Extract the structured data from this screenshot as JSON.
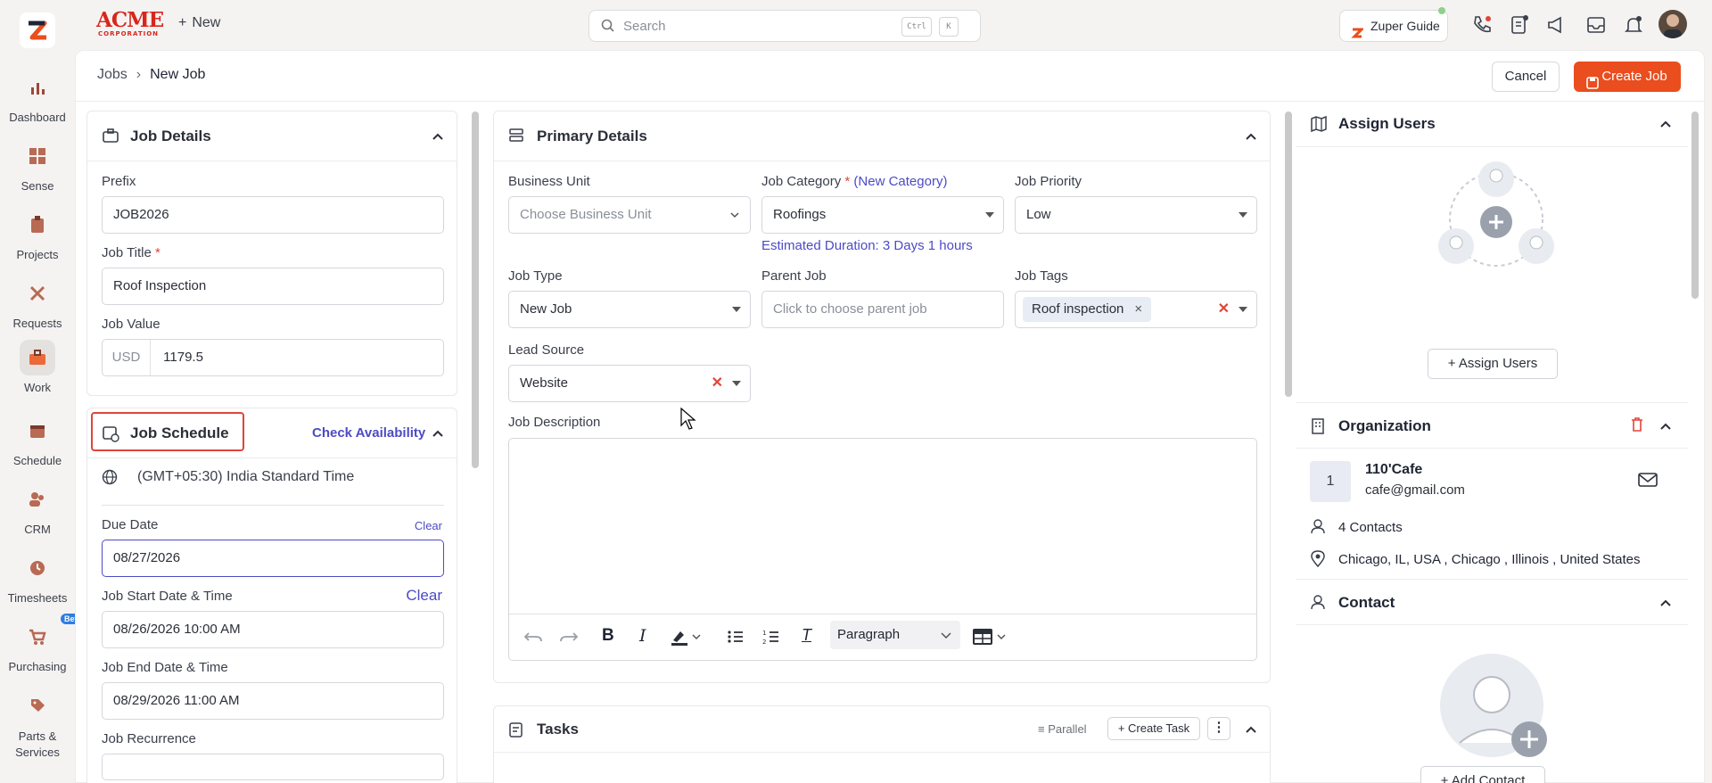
{
  "rail": {
    "items": [
      {
        "label": "Dashboard"
      },
      {
        "label": "Sense"
      },
      {
        "label": "Projects"
      },
      {
        "label": "Requests"
      },
      {
        "label": "Work"
      },
      {
        "label": "Schedule"
      },
      {
        "label": "CRM"
      },
      {
        "label": "Timesheets"
      },
      {
        "label": "Purchasing",
        "badge": "Beta"
      },
      {
        "label": "Parts & Services"
      }
    ]
  },
  "topbar": {
    "brand": "ACME",
    "brand_sub": "CORPORATION",
    "new_label": "New",
    "search_placeholder": "Search",
    "kbd1": "Ctrl",
    "kbd2": "K",
    "guide_label": "Zuper Guide"
  },
  "breadcrumb": {
    "root": "Jobs",
    "current": "New Job"
  },
  "actions": {
    "cancel": "Cancel",
    "create": "Create Job"
  },
  "job_details": {
    "title": "Job Details",
    "prefix_label": "Prefix",
    "prefix_value": "JOB2026",
    "title_label": "Job Title",
    "title_value": "Roof Inspection",
    "value_label": "Job Value",
    "currency": "USD",
    "value": "1179.5"
  },
  "job_schedule": {
    "title": "Job Schedule",
    "check": "Check Availability",
    "timezone": "(GMT+05:30) India Standard Time",
    "due_label": "Due Date",
    "clear": "Clear",
    "due_value": "08/27/2026",
    "start_label": "Job Start Date & Time",
    "start_value": "08/26/2026 10:00 AM",
    "end_label": "Job End Date & Time",
    "end_value": "08/29/2026 11:00 AM",
    "recurrence_label": "Job Recurrence"
  },
  "primary": {
    "title": "Primary Details",
    "bu_label": "Business Unit",
    "bu_placeholder": "Choose Business Unit",
    "cat_label": "Job Category",
    "new_cat": "(New Category)",
    "cat_value": "Roofings",
    "est": "Estimated Duration: 3 Days 1 hours",
    "prio_label": "Job Priority",
    "prio_value": "Low",
    "type_label": "Job Type",
    "type_value": "New Job",
    "parent_label": "Parent Job",
    "parent_placeholder": "Click to choose parent job",
    "tags_label": "Job Tags",
    "tag": "Roof inspection",
    "lead_label": "Lead Source",
    "lead_value": "Website",
    "desc_label": "Job Description",
    "paragraph": "Paragraph"
  },
  "tasks": {
    "title": "Tasks",
    "parallel": "Parallel",
    "create_task": "Create Task"
  },
  "assign": {
    "title": "Assign Users",
    "btn": "Assign Users"
  },
  "org": {
    "title": "Organization",
    "initial": "1",
    "name": "110'Cafe",
    "email": "cafe@gmail.com",
    "contacts": "4 Contacts",
    "address": "Chicago, IL, USA , Chicago , Illinois , United States"
  },
  "contact": {
    "title": "Contact",
    "btn": "Add Contact"
  },
  "colors": {
    "accent": "#ea4d1e",
    "link": "#4d4bc4",
    "danger": "#e0453a"
  }
}
